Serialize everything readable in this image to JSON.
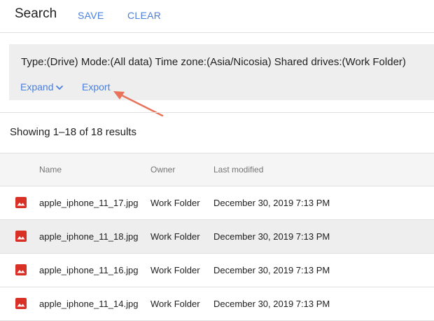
{
  "header": {
    "title": "Search",
    "save_label": "SAVE",
    "clear_label": "CLEAR"
  },
  "filters": {
    "summary": "Type:(Drive) Mode:(All data) Time zone:(Asia/Nicosia) Shared drives:(Work Folder)",
    "expand_label": "Expand",
    "export_label": "Export"
  },
  "results": {
    "count_text": "Showing 1–18 of 18 results",
    "columns": {
      "name": "Name",
      "owner": "Owner",
      "last_modified": "Last modified"
    },
    "rows": [
      {
        "icon": "image-file-icon",
        "name": "apple_iphone_11_17.jpg",
        "owner": "Work Folder",
        "modified": "December 30, 2019 7:13 PM",
        "selected": false
      },
      {
        "icon": "image-file-icon",
        "name": "apple_iphone_11_18.jpg",
        "owner": "Work Folder",
        "modified": "December 30, 2019 7:13 PM",
        "selected": true
      },
      {
        "icon": "image-file-icon",
        "name": "apple_iphone_11_16.jpg",
        "owner": "Work Folder",
        "modified": "December 30, 2019 7:13 PM",
        "selected": false
      },
      {
        "icon": "image-file-icon",
        "name": "apple_iphone_11_14.jpg",
        "owner": "Work Folder",
        "modified": "December 30, 2019 7:13 PM",
        "selected": false
      }
    ]
  },
  "colors": {
    "accent": "#4a7fdc",
    "file_icon": "#d93025",
    "annotation_arrow": "#e8735a",
    "selected_row": "#eeeeee"
  }
}
